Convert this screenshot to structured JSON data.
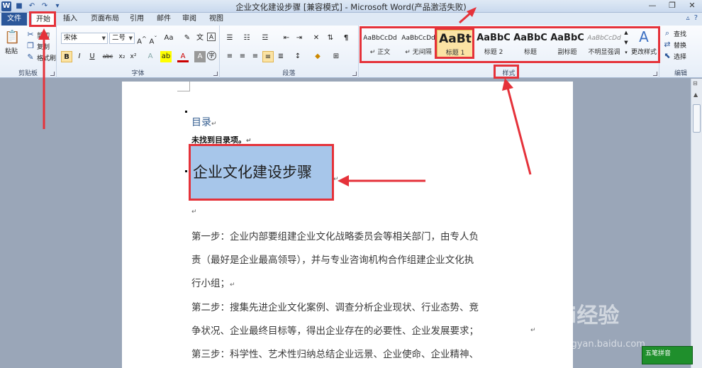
{
  "titlebar": {
    "title": "企业文化建设步骤 [兼容模式] - Microsoft Word(产品激活失败)",
    "controls": [
      "—",
      "❐",
      "✕"
    ]
  },
  "tabs": {
    "file": "文件",
    "items": [
      "开始",
      "插入",
      "页面布局",
      "引用",
      "邮件",
      "审阅",
      "视图"
    ]
  },
  "ribbon": {
    "clipboard": {
      "label": "剪贴板",
      "paste": "粘贴",
      "cut": "剪切",
      "copy": "复制",
      "format_painter": "格式刷"
    },
    "font": {
      "label": "字体",
      "font_name": "宋体",
      "font_size": "二号"
    },
    "paragraph": {
      "label": "段落"
    },
    "styles": {
      "label": "样式",
      "items": [
        {
          "preview": "AaBbCcDd",
          "name": "↵ 正文"
        },
        {
          "preview": "AaBbCcDd",
          "name": "↵ 无间隔"
        },
        {
          "preview": "AaBt",
          "name": "标题 1"
        },
        {
          "preview": "AaBbC",
          "name": "标题 2"
        },
        {
          "preview": "AaBbC",
          "name": "标题"
        },
        {
          "preview": "AaBbC",
          "name": "副标题"
        },
        {
          "preview": "AaBbCcDd",
          "name": "不明显强调"
        }
      ],
      "change_styles": "更改样式"
    },
    "editing": {
      "label": "编辑",
      "find": "查找",
      "replace": "替换",
      "select": "选择"
    }
  },
  "document": {
    "toc_title": "目录",
    "toc_empty": "未找到目录项。",
    "heading": "企业文化建设步骤",
    "paragraphs": [
      "第一步：企业内部要组建企业文化战略委员会等相关部门，由专人负",
      "责（最好是企业最高领导），并与专业咨询机构合作组建企业文化执",
      "行小组；",
      "第二步：搜集先进企业文化案例、调查分析企业现状、行业态势、竞",
      "争状况、企业最终目标等，得出企业存在的必要性、企业发展要求；",
      "第三步：科学性、艺术性归纳总结企业远景、企业使命、企业精神、"
    ]
  },
  "watermark": {
    "brand": "Bai经验",
    "url": "jingyan.baidu.com"
  },
  "ime": {
    "label": "五笔拼音"
  },
  "colors": {
    "accent": "#2b579a",
    "annotation": "#e5323a",
    "selection": "#a7c6ea"
  }
}
